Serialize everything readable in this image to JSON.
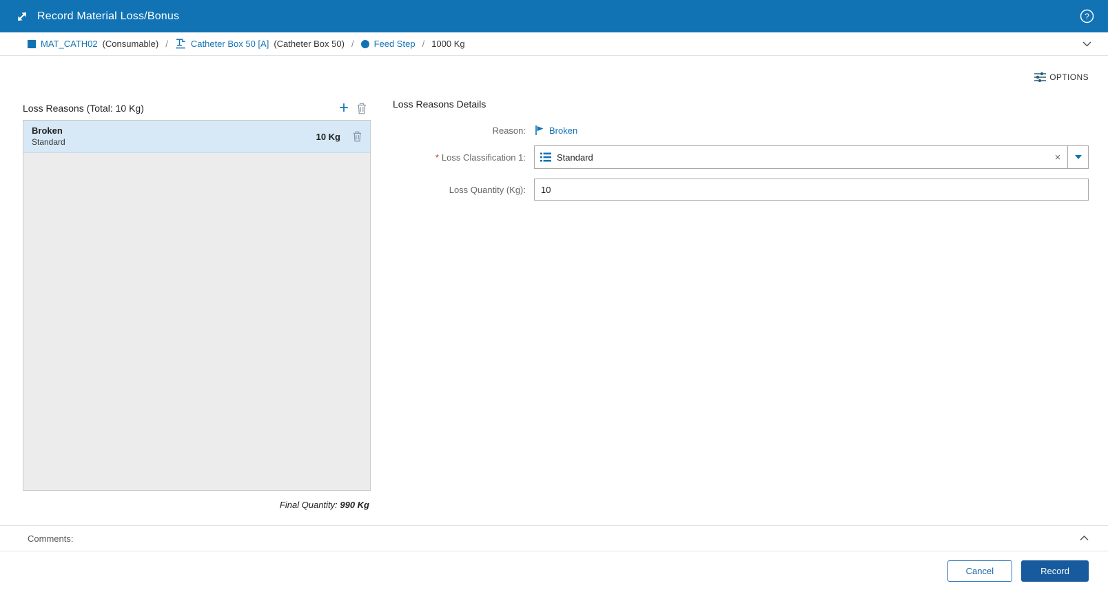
{
  "colors": {
    "accent": "#1173b4",
    "header-bg": "#1173b4",
    "record-bg": "#175a9d",
    "selected-bg": "#d7e9f6",
    "list-bg": "#ececec",
    "asterisk": "#c0392b"
  },
  "header": {
    "title": "Record Material Loss/Bonus"
  },
  "breadcrumb": {
    "material_name": "MAT_CATH02",
    "material_type": "(Consumable)",
    "sep1": "/",
    "resource_name": "Catheter Box 50 [A]",
    "resource_type": "(Catheter Box 50)",
    "sep2": "/",
    "step_name": "Feed Step",
    "sep3": "/",
    "quantity": "1000 Kg"
  },
  "toolbar": {
    "options_label": "OPTIONS"
  },
  "loss_reasons": {
    "title": "Loss Reasons (Total: 10 Kg)",
    "items": [
      {
        "reason": "Broken",
        "classification": "Standard",
        "quantity": "10 Kg"
      }
    ],
    "final_quantity_label": "Final Quantity:",
    "final_quantity_value": "990 Kg"
  },
  "details": {
    "title": "Loss Reasons Details",
    "reason_label": "Reason:",
    "reason_value": "Broken",
    "required_marker": "*",
    "classification_label": "Loss Classification 1:",
    "classification_value": "Standard",
    "clear_glyph": "×",
    "quantity_label": "Loss Quantity (Kg):",
    "quantity_value": "10"
  },
  "comments": {
    "label": "Comments:"
  },
  "footer": {
    "cancel_label": "Cancel",
    "record_label": "Record"
  }
}
